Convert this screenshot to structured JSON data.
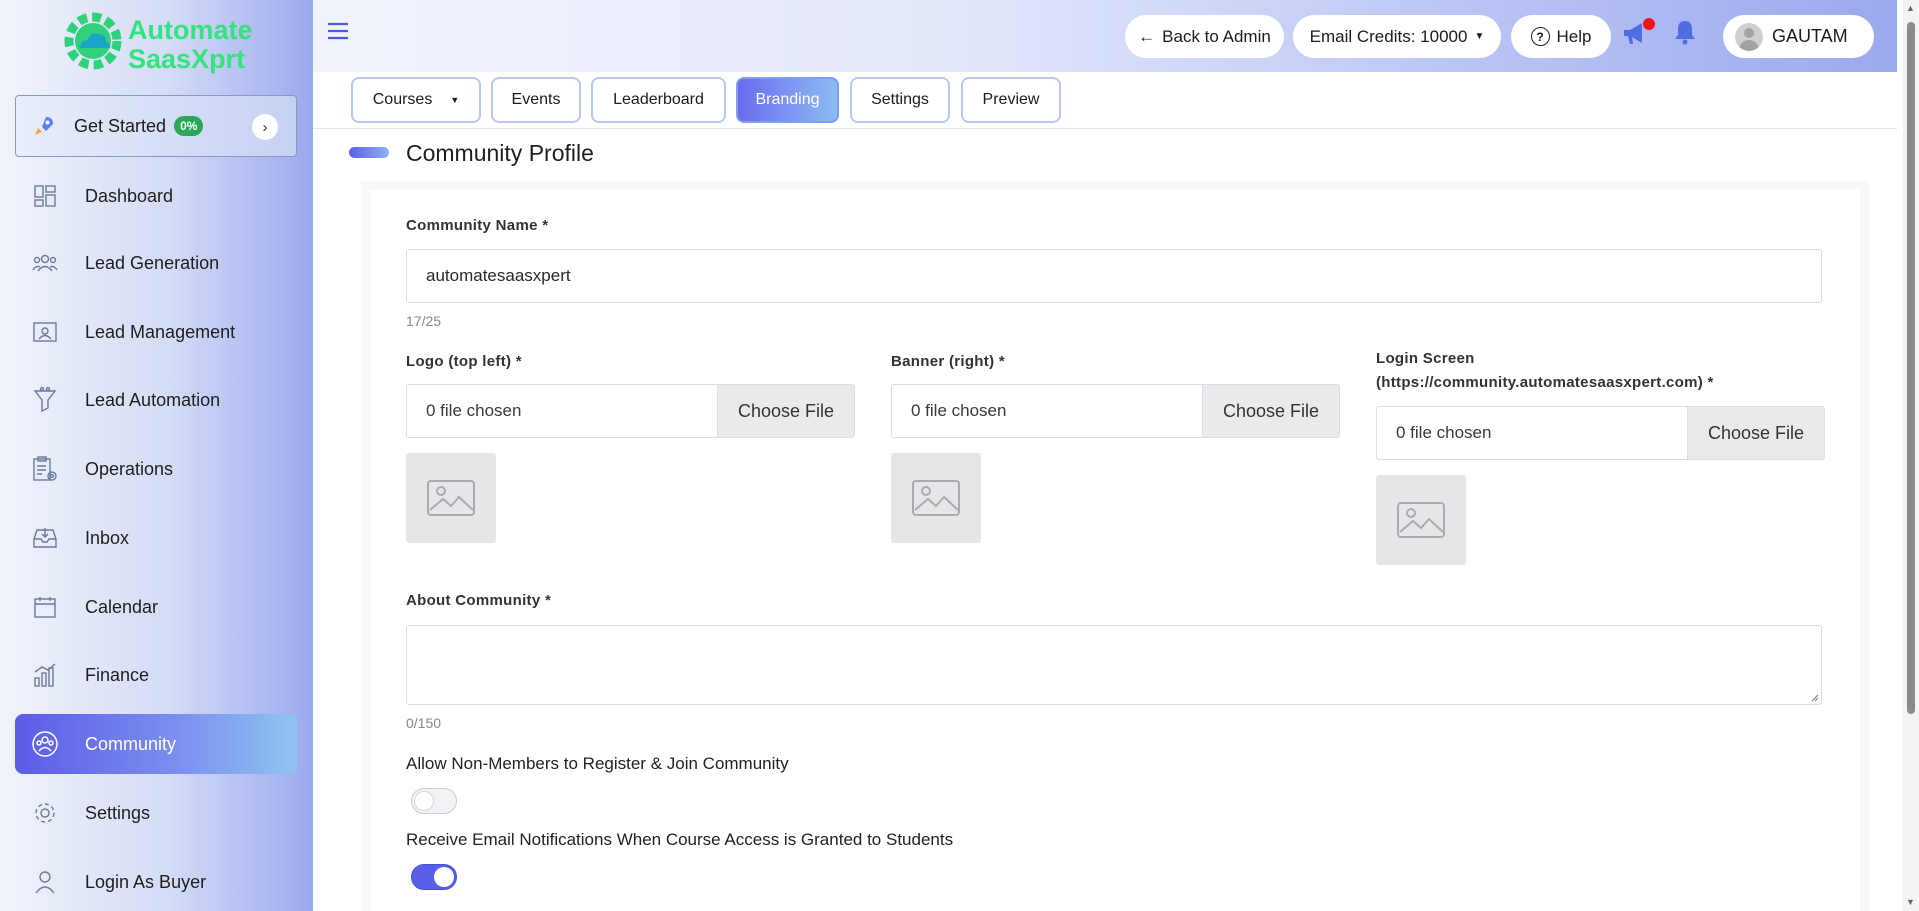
{
  "brand": {
    "line1": "Automate",
    "line2": "SaasXprt"
  },
  "get_started": {
    "label": "Get Started",
    "badge": "0%"
  },
  "sidebar": {
    "items": [
      {
        "label": "Dashboard",
        "icon": "dashboard-icon"
      },
      {
        "label": "Lead Generation",
        "icon": "users-icon"
      },
      {
        "label": "Lead Management",
        "icon": "id-card-icon"
      },
      {
        "label": "Lead Automation",
        "icon": "funnel-icon"
      },
      {
        "label": "Operations",
        "icon": "clipboard-gear-icon"
      },
      {
        "label": "Inbox",
        "icon": "inbox-icon"
      },
      {
        "label": "Calendar",
        "icon": "calendar-icon"
      },
      {
        "label": "Finance",
        "icon": "finance-chart-icon"
      },
      {
        "label": "Community",
        "icon": "community-icon",
        "active": true
      },
      {
        "label": "Settings",
        "icon": "gear-icon"
      },
      {
        "label": "Login As Buyer",
        "icon": "user-icon"
      }
    ]
  },
  "header": {
    "back_label": "Back to Admin",
    "credits_label": "Email Credits: 10000",
    "help_label": "Help",
    "user_name": "GAUTAM"
  },
  "tabs": [
    {
      "label": "Courses",
      "dropdown": true
    },
    {
      "label": "Events"
    },
    {
      "label": "Leaderboard"
    },
    {
      "label": "Branding",
      "active": true
    },
    {
      "label": "Settings"
    },
    {
      "label": "Preview"
    }
  ],
  "section_title": "Community Profile",
  "form": {
    "community_name": {
      "label": "Community Name *",
      "value": "automatesaasxpert",
      "counter": "17/25"
    },
    "logo": {
      "label": "Logo (top left) *",
      "file_text": "0 file chosen",
      "button": "Choose File"
    },
    "banner": {
      "label": "Banner (right) *",
      "file_text": "0 file chosen",
      "button": "Choose File"
    },
    "login_screen": {
      "label_line1": "Login Screen",
      "label_line2": "(https://community.automatesaasxpert.com) *",
      "file_text": "0 file chosen",
      "button": "Choose File"
    },
    "about": {
      "label": "About Community *",
      "value": "",
      "counter": "0/150"
    },
    "allow_non_members": {
      "label": "Allow Non-Members to Register & Join Community",
      "enabled": false
    },
    "email_notifications": {
      "label": "Receive Email Notifications When Course Access is Granted to Students",
      "enabled": true
    }
  },
  "colors": {
    "accent": "#5b5ee8",
    "brand_green": "#34e27e",
    "badge_green": "#29a85a"
  }
}
